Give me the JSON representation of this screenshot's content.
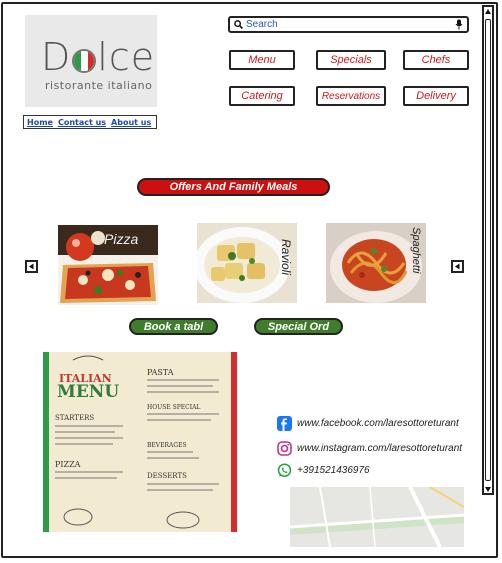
{
  "brand": {
    "logo_word_pre": "D",
    "logo_word_post": "lce",
    "tagline": "ristorante italiano",
    "italian_flag": {
      "green": "#2e9b48",
      "white": "#ffffff",
      "red": "#d32d2d"
    }
  },
  "top_links": [
    "Home",
    "Contact us",
    "About us"
  ],
  "search": {
    "placeholder": "Search"
  },
  "nav": {
    "row1": [
      "Menu",
      "Specials",
      "Chefs"
    ],
    "row2": [
      "Catering",
      "Reservations",
      "Delivery"
    ]
  },
  "offers": {
    "title": "Offers And Family Meals"
  },
  "carousel": {
    "items": [
      {
        "label": "Pizza"
      },
      {
        "label": "Ravioli"
      },
      {
        "label": "Spaghetti"
      }
    ]
  },
  "actions": {
    "book": "Book a tabl",
    "special": "Special Ord"
  },
  "menu_card": {
    "title_top": "ITALIAN",
    "title_bottom": "MENU",
    "sections": [
      "PASTA",
      "STARTERS",
      "HOUSE SPECIAL",
      "BEVERAGES",
      "PIZZA",
      "DESSERTS"
    ]
  },
  "social": {
    "facebook": "www.facebook.com/laresottoreturant",
    "instagram": "www.instagram.com/laresottoreturant",
    "whatsapp": "+391521436976"
  },
  "colors": {
    "accent_red": "#cc1010",
    "accent_green": "#3f7d2c",
    "nav_text": "#cc1a1a",
    "link_blue": "#1a4aa8"
  }
}
